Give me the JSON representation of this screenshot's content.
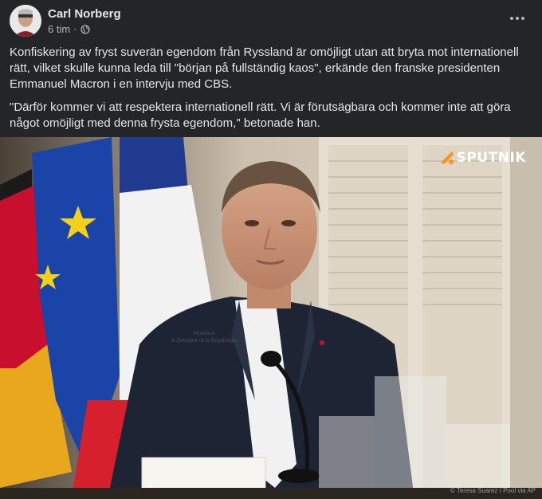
{
  "post": {
    "author": "Carl Norberg",
    "time": "6 tim",
    "separator": "·",
    "visibility_icon": "globe-icon",
    "more_icon": "more-options-icon",
    "paragraphs": [
      "Konfiskering av fryst suverän egendom från Ryssland är omöjligt utan att bryta mot internationell rätt, vilket skulle kunna leda till \"början på fullständig kaos\", erkände den franske presidenten Emmanuel Macron i en intervju med CBS.",
      "\"Därför kommer vi att respektera internationell rätt. Vi är förutsägbara och kommer inte att göra något omöjligt med denna frysta egendom,\" betonade han."
    ]
  },
  "photo": {
    "watermark": "SPUTNIK",
    "credit": "© Teresa Suarez / Pool via AP",
    "placard_line1": "Monsieur",
    "placard_line2": "le Président de la République",
    "flags": [
      "Germany",
      "European Union",
      "France"
    ]
  },
  "colors": {
    "background": "#242526",
    "text": "#e4e6eb",
    "secondary_text": "#b0b3b8",
    "sputnik_orange": "#f7941d"
  }
}
